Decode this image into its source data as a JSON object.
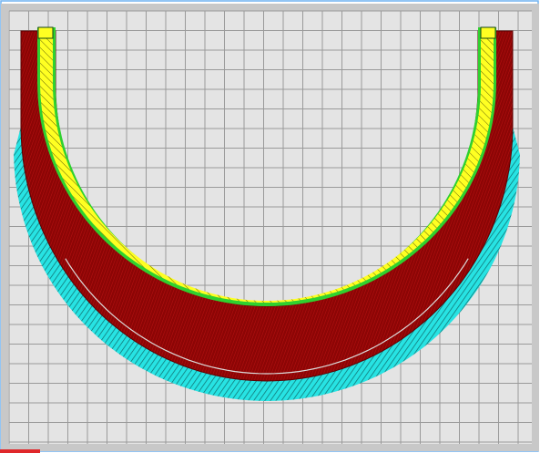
{
  "viewer": {
    "background_color": "#ffffff",
    "build_plate_color": "#e4e4e4",
    "build_plate_edge_color": "#c8c8c8",
    "grid_color": "#9a9a9a",
    "frame_color": "#6fb2f0"
  },
  "layer_view": {
    "colors": {
      "skirt_support": "#27e3e3",
      "skirt_lines": "#0f6a6a",
      "outer_wall": "#8c0505",
      "outer_wall_texture": "#c21414",
      "inner_wall": "#2fd12f",
      "infill": "#ffff22",
      "infill_hatch": "#6a6a08",
      "top_edge": "#dcdcdc"
    }
  },
  "status": {
    "progress_fraction": 0.075,
    "progress_color": "#e0282a"
  }
}
